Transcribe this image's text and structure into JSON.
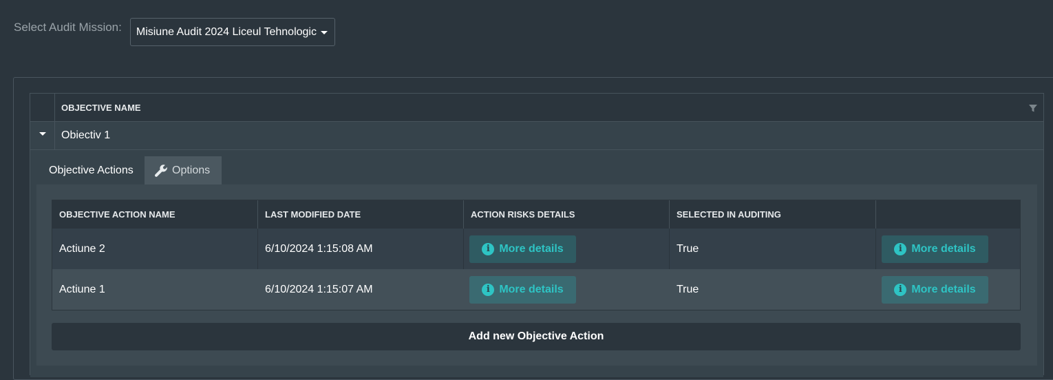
{
  "mission": {
    "label": "Select Audit Mission:",
    "selected": "Misiune Audit 2024 Liceul Tehnologic"
  },
  "grid": {
    "header": "OBJECTIVE NAME",
    "filter_icon": "filter-icon",
    "rows": [
      {
        "name": "Obiectiv 1",
        "expanded": true
      }
    ]
  },
  "detail": {
    "tabs": [
      {
        "label": "Objective Actions",
        "active": true
      },
      {
        "label": "Options",
        "active": false,
        "icon": "wrench-icon"
      }
    ],
    "table": {
      "columns": [
        "OBJECTIVE ACTION NAME",
        "LAST MODIFIED DATE",
        "ACTION RISKS DETAILS",
        "SELECTED IN AUDITING",
        ""
      ],
      "rows": [
        {
          "name": "Actiune 2",
          "modified": "6/10/2024 1:15:08 AM",
          "risks_button": "More details",
          "selected": "True",
          "details_button": "More details"
        },
        {
          "name": "Actiune 1",
          "modified": "6/10/2024 1:15:07 AM",
          "risks_button": "More details",
          "selected": "True",
          "details_button": "More details"
        }
      ]
    },
    "add_button": "Add new Objective Action"
  },
  "colors": {
    "background": "#2b353d",
    "accent": "#2ec4c4",
    "button_bg": "#2f5b62"
  }
}
